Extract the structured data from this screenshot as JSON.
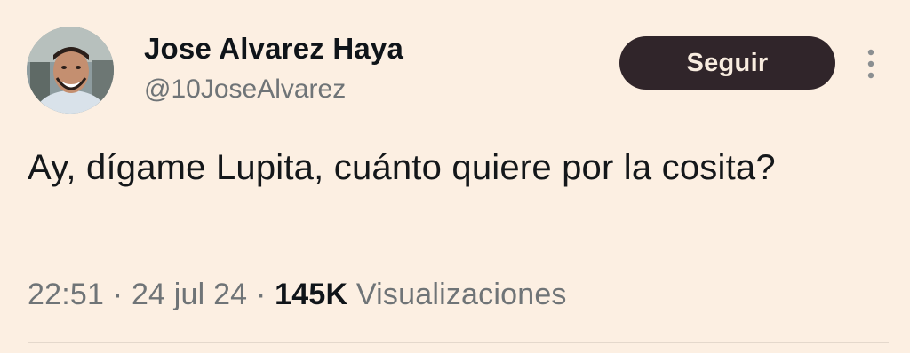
{
  "author": {
    "name": "Jose Alvarez Haya",
    "handle": "@10JoseAlvarez"
  },
  "follow_button": {
    "label": "Seguir"
  },
  "more_menu": {
    "icon": "more-vertical-icon"
  },
  "tweet": {
    "text": "Ay, dígame Lupita, cuánto quiere por la cosita?",
    "time": "22:51",
    "date": "24 jul 24",
    "views_count": "145K",
    "views_label": "Visualizaciones",
    "separator": "·"
  },
  "colors": {
    "background": "#fcefe2",
    "follow_button_bg": "#30252a",
    "follow_button_text": "#f8ecdf",
    "muted_text": "#6f7477",
    "primary_text": "#14171a"
  }
}
